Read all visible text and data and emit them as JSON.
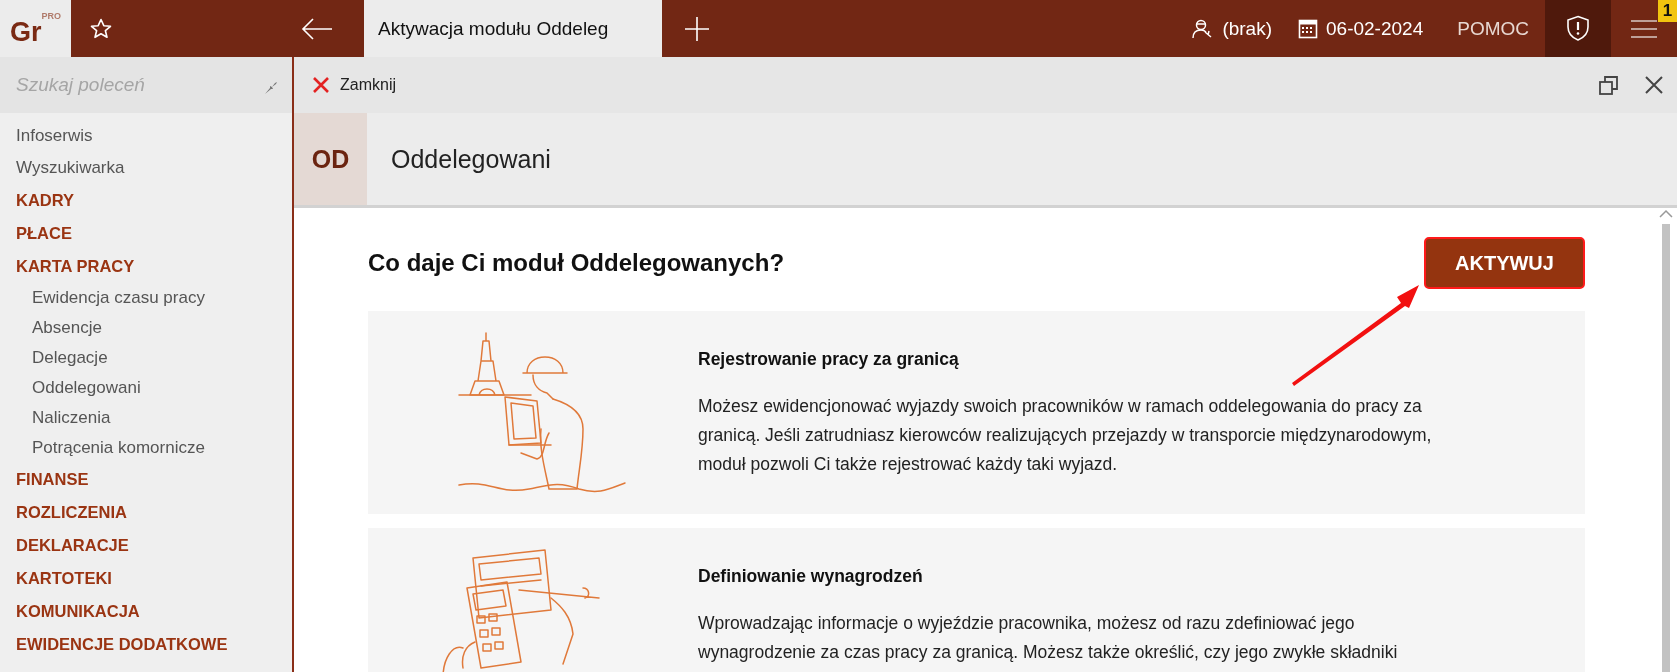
{
  "app": {
    "logo": "Gr",
    "logo_badge": "PRO"
  },
  "topbar": {
    "tab": {
      "label": "Aktywacja modułu Oddeleg",
      "selected": true
    },
    "user": "(brak)",
    "date": "06-02-2024",
    "help": "POMOC",
    "notification_count": "1"
  },
  "sidebar": {
    "search": {
      "placeholder": "Szukaj poleceń"
    },
    "items": [
      {
        "label": "Infoserwis",
        "kind": "link"
      },
      {
        "label": "Wyszukiwarka",
        "kind": "link"
      },
      {
        "label": "KADRY",
        "kind": "section"
      },
      {
        "label": "PŁACE",
        "kind": "section"
      },
      {
        "label": "KARTA PRACY",
        "kind": "section",
        "children": [
          {
            "label": "Ewidencja czasu pracy",
            "kind": "link"
          },
          {
            "label": "Absencje",
            "kind": "link"
          },
          {
            "label": "Delegacje",
            "kind": "link"
          },
          {
            "label": "Oddelegowani",
            "kind": "link"
          },
          {
            "label": "Naliczenia",
            "kind": "link"
          },
          {
            "label": "Potrącenia komornicze",
            "kind": "link"
          }
        ]
      },
      {
        "label": "FINANSE",
        "kind": "section"
      },
      {
        "label": "ROZLICZENIA",
        "kind": "section"
      },
      {
        "label": "DEKLARACJE",
        "kind": "section"
      },
      {
        "label": "KARTOTEKI",
        "kind": "section"
      },
      {
        "label": "KOMUNIKACJA",
        "kind": "section"
      },
      {
        "label": "EWIDENCJE DODATKOWE",
        "kind": "section"
      }
    ]
  },
  "toolbar": {
    "close_label": "Zamknij"
  },
  "module": {
    "badge": "OD",
    "title": "Oddelegowani"
  },
  "content": {
    "heading": "Co daje Ci moduł Oddelegowanych?",
    "button": "AKTYWUJ",
    "features": [
      {
        "kind": "worker",
        "title": "Rejestrowanie pracy za granicą",
        "body": "Możesz ewidencjonować wyjazdy swoich pracowników w ramach oddelegowania do pracy za granicą. Jeśli zatrudniasz kierowców realizujących przejazdy w transporcie międzynarodowym, moduł pozwoli Ci także rejestrować każdy taki wyjazd."
      },
      {
        "kind": "calculator",
        "title": "Definiowanie wynagrodzeń",
        "body": "Wprowadzając informacje o wyjeździe pracownika, możesz od razu zdefiniować jego wynagrodzenie za czas pracy za granicą. Możesz także określić, czy jego zwykłe składniki"
      }
    ]
  }
}
